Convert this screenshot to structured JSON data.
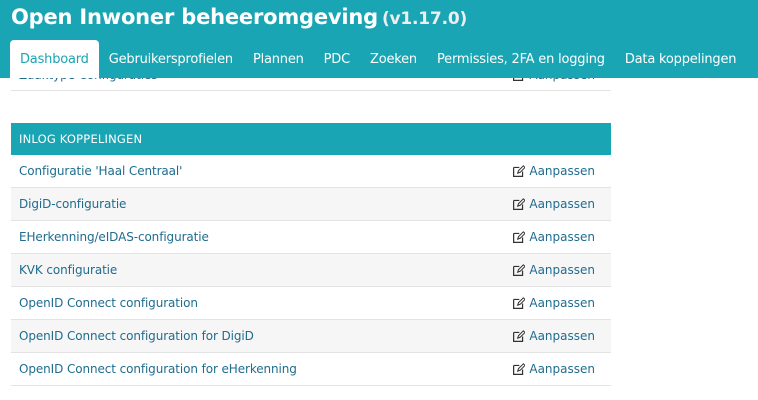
{
  "header": {
    "title": "Open Inwoner beheeromgeving",
    "version": "(v1.17.0)"
  },
  "nav": {
    "tabs": [
      {
        "label": "Dashboard",
        "active": true
      },
      {
        "label": "Gebruikersprofielen"
      },
      {
        "label": "Plannen"
      },
      {
        "label": "PDC"
      },
      {
        "label": "Zoeken"
      },
      {
        "label": "Permissies, 2FA en logging"
      },
      {
        "label": "Data koppelingen"
      }
    ]
  },
  "previous_row": {
    "label": "Zaaktype Configuraties",
    "action": "Aanpassen"
  },
  "section": {
    "caption": "INLOG KOPPELINGEN",
    "rows": [
      {
        "label": "Configuratie 'Haal Centraal'",
        "action": "Aanpassen"
      },
      {
        "label": "DigiD-configuratie",
        "action": "Aanpassen"
      },
      {
        "label": "EHerkenning/eIDAS-configuratie",
        "action": "Aanpassen"
      },
      {
        "label": "KVK configuratie",
        "action": "Aanpassen"
      },
      {
        "label": "OpenID Connect configuration",
        "action": "Aanpassen"
      },
      {
        "label": "OpenID Connect configuration for DigiD",
        "action": "Aanpassen"
      },
      {
        "label": "OpenID Connect configuration for eHerkenning",
        "action": "Aanpassen"
      }
    ]
  },
  "colors": {
    "accent": "#19a5b4",
    "link": "#1f6c8e"
  },
  "icons": {
    "edit": "edit-icon"
  }
}
